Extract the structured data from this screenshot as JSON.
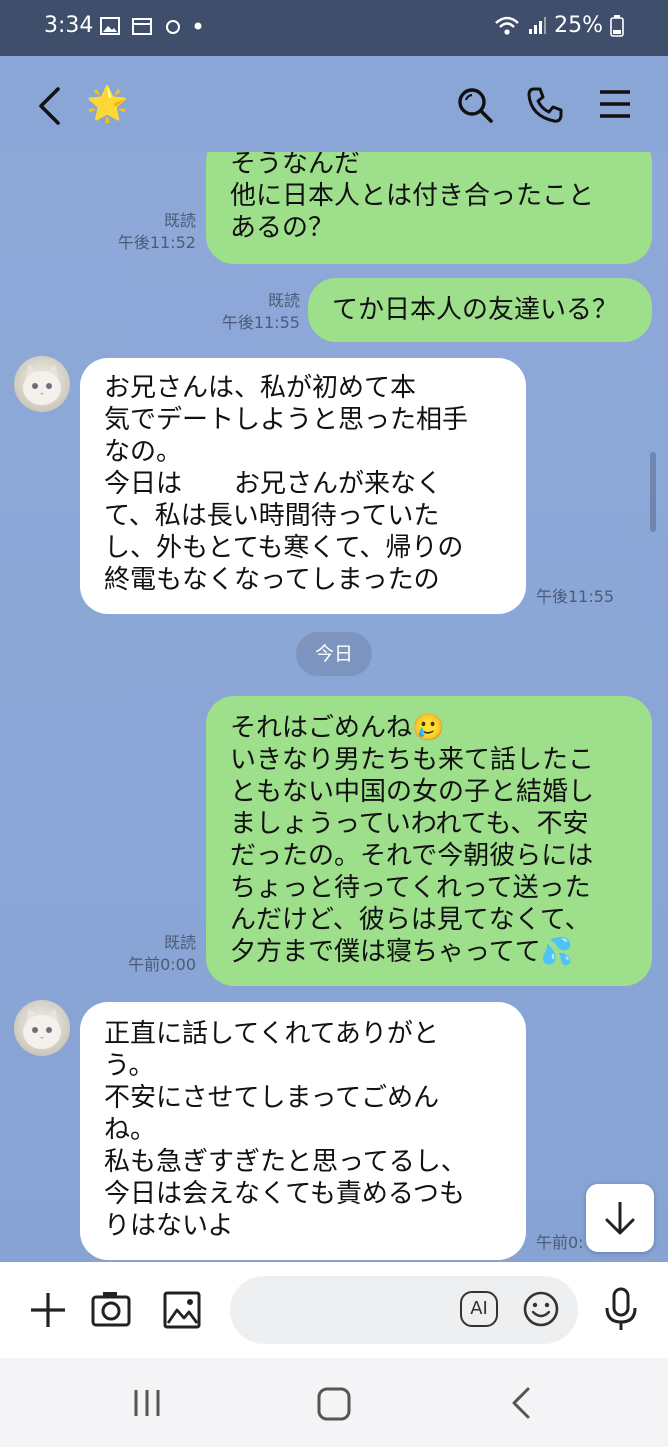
{
  "status_bar": {
    "time": "3:34",
    "battery": "25%"
  },
  "header": {
    "contact_emoji": "🌟"
  },
  "messages": [
    {
      "dir": "out",
      "text": "そうなんだ\n他に日本人とは付き合ったこと\nあるの？",
      "read": "既読",
      "time": "午後11:52"
    },
    {
      "dir": "out",
      "text": "てか日本人の友達いる？",
      "read": "既読",
      "time": "午後11:55"
    },
    {
      "dir": "in",
      "text": "お兄さんは、私が初めて本\n気でデートしようと思った相手\nなの。\n今日は　　お兄さんが来なく\nて、私は長い時間待っていた\nし、外もとても寒くて、帰りの\n終電もなくなってしまったの",
      "time": "午後11:55"
    },
    {
      "dir": "out",
      "text": "それはごめんね🥲\nいきなり男たちも来て話したこ\nともない中国の女の子と結婚し\nましょうっていわれても、不安\nだったの。それで今朝彼らには\nちょっと待ってくれって送った\nんだけど、彼らは見てなくて、\n夕方まで僕は寝ちゃってて💦",
      "read": "既読",
      "time": "午前0:00"
    },
    {
      "dir": "in",
      "text": "正直に話してくれてありがと\nう。\n不安にさせてしまってごめん\nね。\n私も急ぎすぎたと思ってるし、\n今日は会えなくても責めるつも\nりはないよ",
      "time": "午前0:"
    }
  ],
  "date_divider": "今日",
  "input": {
    "ai_label": "AI"
  },
  "colors": {
    "chat_bg": "#8aa6d6",
    "outgoing_bubble": "#9ddf8b",
    "incoming_bubble": "#ffffff",
    "status_bar": "#3f4f6b"
  },
  "icons": [
    "back-icon",
    "search-icon",
    "phone-icon",
    "menu-icon",
    "plus-icon",
    "camera-icon",
    "image-icon",
    "ai-icon",
    "emoji-icon",
    "mic-icon",
    "scroll-down-icon",
    "recents-icon",
    "home-icon",
    "nav-back-icon"
  ]
}
